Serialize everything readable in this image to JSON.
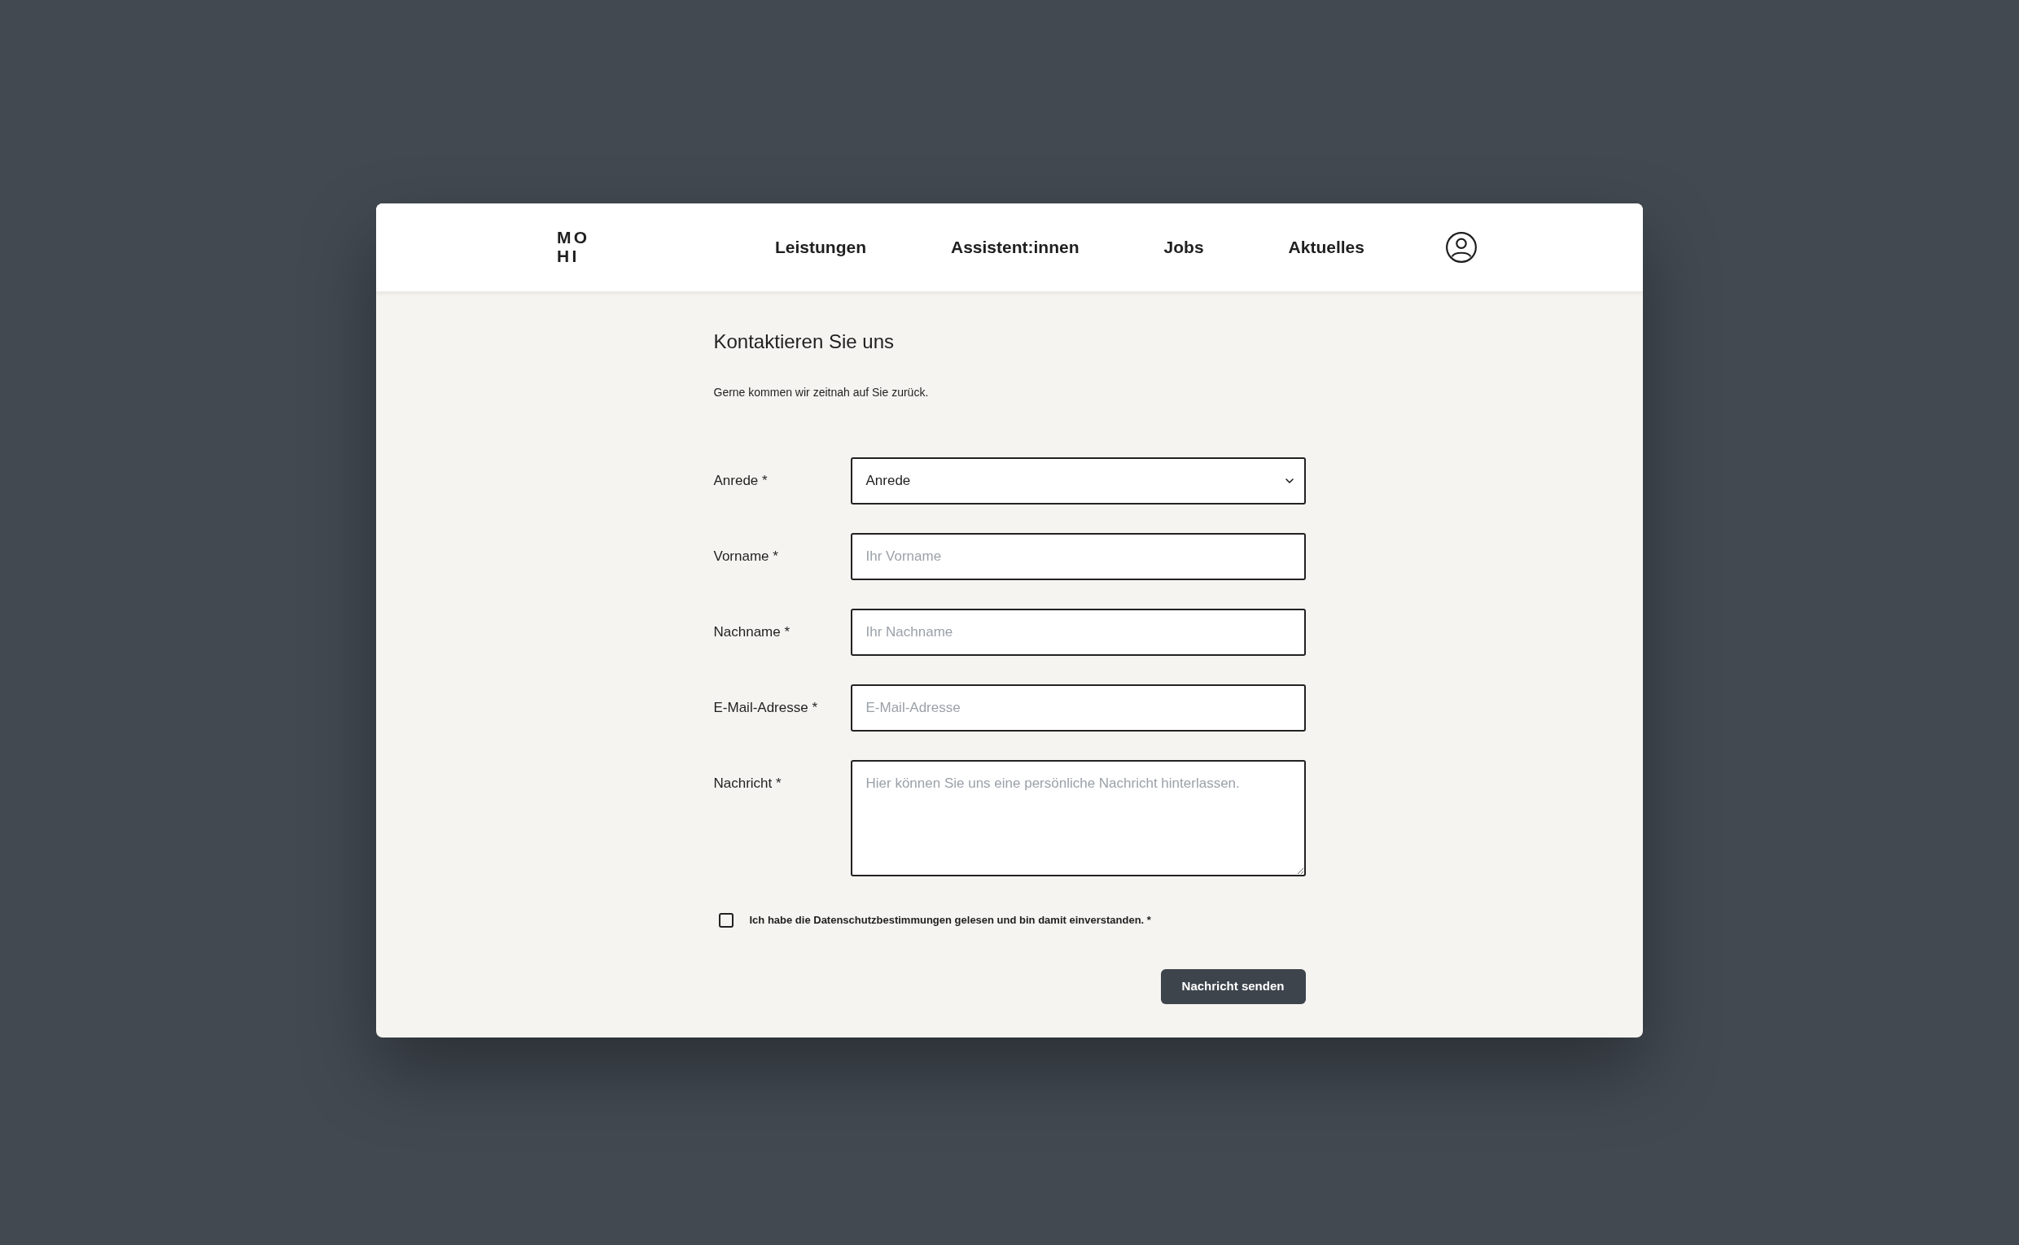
{
  "header": {
    "logo": {
      "lines": [
        "MO",
        "HI"
      ]
    },
    "nav": [
      {
        "label": "Leistungen"
      },
      {
        "label": "Assistent:innen"
      },
      {
        "label": "Jobs"
      },
      {
        "label": "Aktuelles"
      }
    ]
  },
  "contact_form": {
    "title": "Kontaktieren Sie uns",
    "subtitle": "Gerne kommen wir zeitnah auf Sie zurück.",
    "fields": [
      {
        "kind": "select",
        "label": "Anrede *",
        "value": "Anrede"
      },
      {
        "kind": "text",
        "label": "Vorname *",
        "placeholder": "Ihr Vorname"
      },
      {
        "kind": "text",
        "label": "Nachname *",
        "placeholder": "Ihr Nachname"
      },
      {
        "kind": "text",
        "label": "E-Mail-Adresse *",
        "placeholder": "E-Mail-Adresse"
      },
      {
        "kind": "textarea",
        "label": "Nachricht *",
        "placeholder": "Hier können Sie uns eine persönliche Nachricht hinterlassen."
      }
    ],
    "consent": {
      "label": "Ich habe die Datenschutzbestimmungen gelesen und bin damit einverstanden. *",
      "checked": false
    },
    "submit": {
      "label": "Nachricht senden"
    }
  }
}
